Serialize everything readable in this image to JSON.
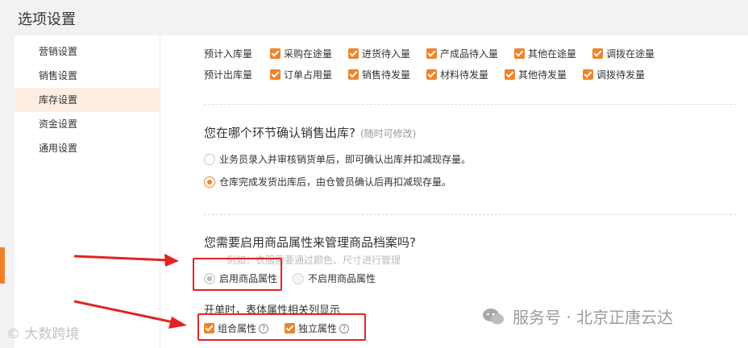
{
  "header": {
    "title": "选项设置"
  },
  "sidebar": {
    "items": [
      {
        "label": "营销设置",
        "active": false
      },
      {
        "label": "销售设置",
        "active": false
      },
      {
        "label": "库存设置",
        "active": true
      },
      {
        "label": "资金设置",
        "active": false
      },
      {
        "label": "通用设置",
        "active": false
      }
    ]
  },
  "inventory": {
    "row_in": {
      "label": "预计入库量",
      "options": [
        "采购在途量",
        "进货待入量",
        "产成品待入量",
        "其他在途量",
        "调拨在途量"
      ]
    },
    "row_out": {
      "label": "预计出库量",
      "options": [
        "订单占用量",
        "销售待发量",
        "材料待发量",
        "其他待发量",
        "调拨待发量"
      ]
    }
  },
  "section_outbound": {
    "question": "您在哪个环节确认销售出库?",
    "hint": "(随时可修改)",
    "option1": "业务员录入并审核销货单后，即可确认出库并扣减现存量。",
    "option2": "仓库完成发货出库后，由仓管员确认后再扣减现存量。",
    "selected": 2
  },
  "section_attr": {
    "question": "您需要启用商品属性来管理商品档案吗?",
    "example": "例如：衣服需要通过颜色、尺寸进行管理",
    "enable_label": "启用商品属性",
    "disable_label": "不启用商品属性",
    "sub_title": "开单时，表体属性相关列显示",
    "combo_label": "组合属性",
    "independent_label": "独立属性",
    "help_glyph": "?"
  },
  "watermark": {
    "text": "服务号 · 北京正唐云达",
    "left_text": "大数跨境"
  },
  "colors": {
    "accent": "#f0842a",
    "highlight": "#e02424",
    "active_bg": "#fdeee4"
  }
}
